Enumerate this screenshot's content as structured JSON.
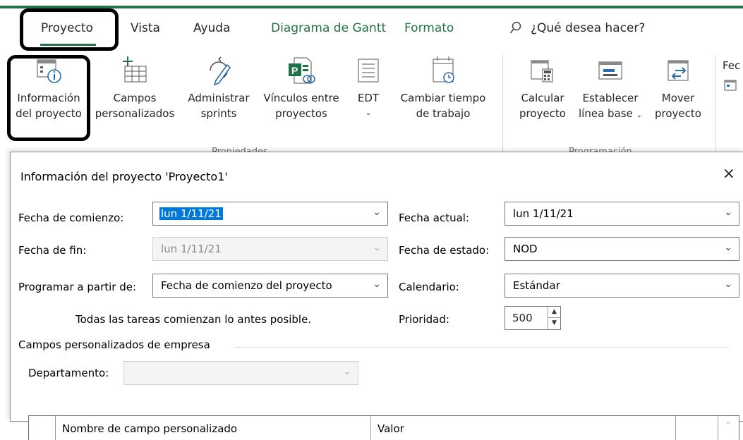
{
  "tabs": {
    "proyecto": "Proyecto",
    "vista": "Vista",
    "ayuda": "Ayuda",
    "diagrama_gantt": "Diagrama de Gantt",
    "formato": "Formato",
    "search_placeholder": "¿Qué desea hacer?"
  },
  "ribbon": {
    "info_line1": "Información",
    "info_line2": "del proyecto",
    "campos_line1": "Campos",
    "campos_line2": "personalizados",
    "sprints_line1": "Administrar",
    "sprints_line2": "sprints",
    "vinculos_line1": "Vínculos entre",
    "vinculos_line2": "proyectos",
    "edt": "EDT",
    "cambiar_line1": "Cambiar tiempo",
    "cambiar_line2": "de trabajo",
    "calcular_line1": "Calcular",
    "calcular_line2": "proyecto",
    "establecer_line1": "Establecer",
    "establecer_line2": "línea base",
    "mover_line1": "Mover",
    "mover_line2": "proyecto",
    "fec_partial": "Fec",
    "group_propiedades": "Propiedades",
    "group_programacion": "Programación"
  },
  "dialog": {
    "title": "Información del proyecto 'Proyecto1'",
    "close": "×",
    "fecha_comienzo_label": "Fecha de comienzo:",
    "fecha_comienzo_value": "lun 1/11/21",
    "fecha_fin_label": "Fecha de fin:",
    "fecha_fin_value": "lun 1/11/21",
    "programar_label": "Programar a partir de:",
    "programar_value": "Fecha de comienzo del proyecto",
    "todas_tareas_text": "Todas las tareas comienzan lo antes posible.",
    "fecha_actual_label": "Fecha actual:",
    "fecha_actual_value": "lun 1/11/21",
    "fecha_estado_label": "Fecha de estado:",
    "fecha_estado_value": "NOD",
    "calendario_label": "Calendario:",
    "calendario_value": "Estándar",
    "prioridad_label": "Prioridad:",
    "prioridad_value": "500",
    "campos_empresa_label": "Campos personalizados de empresa",
    "departamento_label": "Departamento:",
    "departamento_value": "",
    "grid_headers": [
      "Nombre de campo personalizado",
      "Valor"
    ]
  }
}
